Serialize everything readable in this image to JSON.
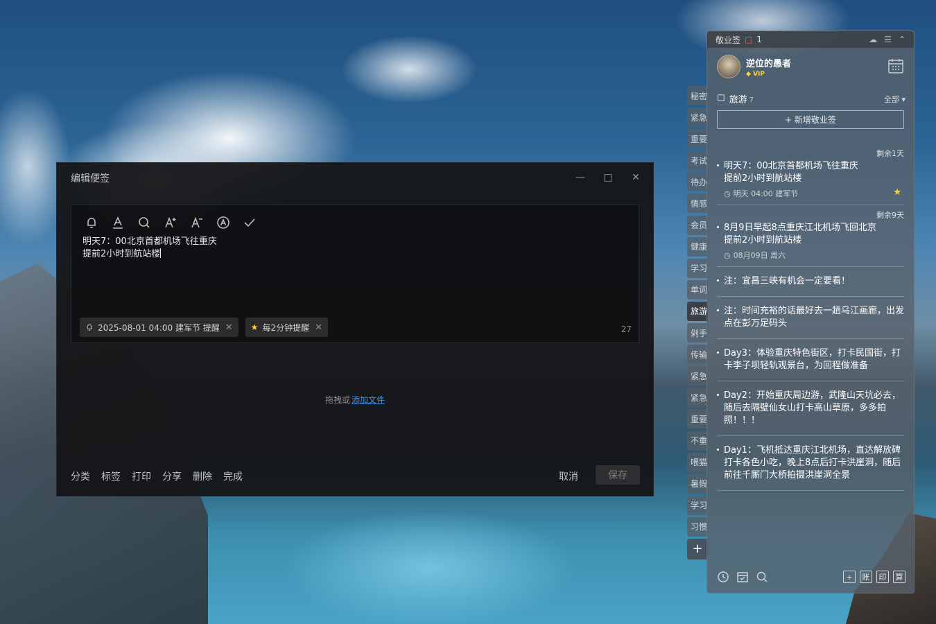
{
  "editor": {
    "title": "编辑便签",
    "text_line1": "明天7：00北京首都机场飞往重庆",
    "text_line2": "提前2小时到航站楼",
    "chip_reminder": "2025-08-01 04:00 建军节 提醒",
    "chip_repeat": "每2分钟提醒",
    "char_count": "27",
    "drop_text": "拖拽或",
    "drop_link": "添加文件",
    "footer": {
      "category": "分类",
      "tag": "标签",
      "print": "打印",
      "share": "分享",
      "delete": "删除",
      "done": "完成"
    },
    "cancel": "取消",
    "save": "保存"
  },
  "side_tabs": [
    "秘密",
    "紧急",
    "重要",
    "考试",
    "待办",
    "情感",
    "会员",
    "健康",
    "学习",
    "单词",
    "旅游",
    "剁手",
    "传输",
    "紧急",
    "紧急",
    "重要",
    "不重",
    "喂猫",
    "暑假",
    "学习",
    "习惯"
  ],
  "side_tabs_active": "旅游",
  "panel": {
    "app_name": "敬业签",
    "notify_count": "1",
    "username": "逆位的愚者",
    "vip": "VIP",
    "category": "旅游",
    "category_count": "7",
    "filter": "全部",
    "new_note": "+ 新增敬业签",
    "notes": [
      {
        "remain": "剩余1天",
        "line1": "明天7：00北京首都机场飞往重庆",
        "line2": "提前2小时到航站楼",
        "meta": "明天 04:00 建军节"
      },
      {
        "remain": "剩余9天",
        "line1": "8月9日早起8点重庆江北机场飞回北京",
        "line2": "提前2小时到航站楼",
        "meta": "08月09日 周六"
      },
      {
        "text": "注：宜昌三峡有机会一定要看！"
      },
      {
        "text": "注：时间充裕的话最好去一趟乌江画廊，出发点在彭万足码头"
      },
      {
        "text": "Day3：体验重庆特色街区，打卡民国街，打卡李子坝轻轨观景台，为回程做准备"
      },
      {
        "text": "Day2：开始重庆周边游，武隆山天坑必去，随后去隔壁仙女山打卡高山草原，多多拍照！！！"
      },
      {
        "text": "Day1：飞机抵达重庆江北机场，直达解放碑打卡各色小吃，晚上8点后打卡洪崖洞，随后前往千厮门大桥拍摄洪崖洞全景"
      }
    ],
    "bottom_right": [
      "+",
      "账",
      "印",
      "算"
    ]
  }
}
